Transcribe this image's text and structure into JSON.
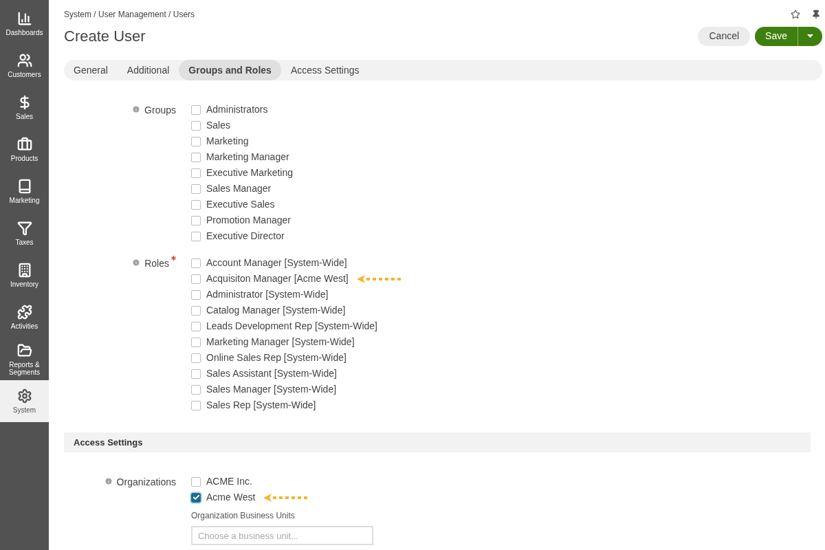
{
  "sidebar": {
    "items": [
      {
        "kind": "dashboards",
        "label": "Dashboards",
        "selected": false
      },
      {
        "kind": "customers",
        "label": "Customers",
        "selected": false
      },
      {
        "kind": "sales",
        "label": "Sales",
        "selected": false
      },
      {
        "kind": "products",
        "label": "Products",
        "selected": false
      },
      {
        "kind": "marketing",
        "label": "Marketing",
        "selected": false
      },
      {
        "kind": "taxes",
        "label": "Taxes",
        "selected": false
      },
      {
        "kind": "inventory",
        "label": "Inventory",
        "selected": false
      },
      {
        "kind": "activities",
        "label": "Activities",
        "selected": false
      },
      {
        "kind": "reports",
        "label": "Reports & Segments",
        "selected": false
      },
      {
        "kind": "system",
        "label": "System",
        "selected": true
      }
    ]
  },
  "breadcrumb": "System / User Management / Users",
  "title": "Create User",
  "buttons": {
    "cancel": "Cancel",
    "save": "Save"
  },
  "tabs": [
    {
      "label": "General",
      "selected": false
    },
    {
      "label": "Additional",
      "selected": false
    },
    {
      "label": "Groups and Roles",
      "selected": true
    },
    {
      "label": "Access Settings",
      "selected": false
    }
  ],
  "groups": {
    "label": "Groups",
    "required": false,
    "options": [
      {
        "label": "Administrators",
        "checked": false,
        "pointer": false
      },
      {
        "label": "Sales",
        "checked": false,
        "pointer": false
      },
      {
        "label": "Marketing",
        "checked": false,
        "pointer": false
      },
      {
        "label": "Marketing Manager",
        "checked": false,
        "pointer": false
      },
      {
        "label": "Executive Marketing",
        "checked": false,
        "pointer": false
      },
      {
        "label": "Sales Manager",
        "checked": false,
        "pointer": false
      },
      {
        "label": "Executive Sales",
        "checked": false,
        "pointer": false
      },
      {
        "label": "Promotion Manager",
        "checked": false,
        "pointer": false
      },
      {
        "label": "Executive Director",
        "checked": false,
        "pointer": false
      }
    ]
  },
  "roles": {
    "label": "Roles",
    "required": true,
    "options": [
      {
        "label": "Account Manager [System-Wide]",
        "checked": false,
        "pointer": false
      },
      {
        "label": "Acquisiton Manager [Acme West]",
        "checked": false,
        "pointer": true
      },
      {
        "label": "Administrator [System-Wide]",
        "checked": false,
        "pointer": false
      },
      {
        "label": "Catalog Manager [System-Wide]",
        "checked": false,
        "pointer": false
      },
      {
        "label": "Leads Development Rep [System-Wide]",
        "checked": false,
        "pointer": false
      },
      {
        "label": "Marketing Manager [System-Wide]",
        "checked": false,
        "pointer": false
      },
      {
        "label": "Online Sales Rep [System-Wide]",
        "checked": false,
        "pointer": false
      },
      {
        "label": "Sales Assistant [System-Wide]",
        "checked": false,
        "pointer": false
      },
      {
        "label": "Sales Manager [System-Wide]",
        "checked": false,
        "pointer": false
      },
      {
        "label": "Sales Rep [System-Wide]",
        "checked": false,
        "pointer": false
      }
    ]
  },
  "access_section": "Access Settings",
  "organizations": {
    "label": "Organizations",
    "required": false,
    "options": [
      {
        "label": "ACME Inc.",
        "checked": false,
        "pointer": false
      },
      {
        "label": "Acme West",
        "checked": true,
        "pointer": true
      }
    ]
  },
  "business_units": {
    "label": "Organization Business Units",
    "placeholder": "Choose a business unit..."
  }
}
